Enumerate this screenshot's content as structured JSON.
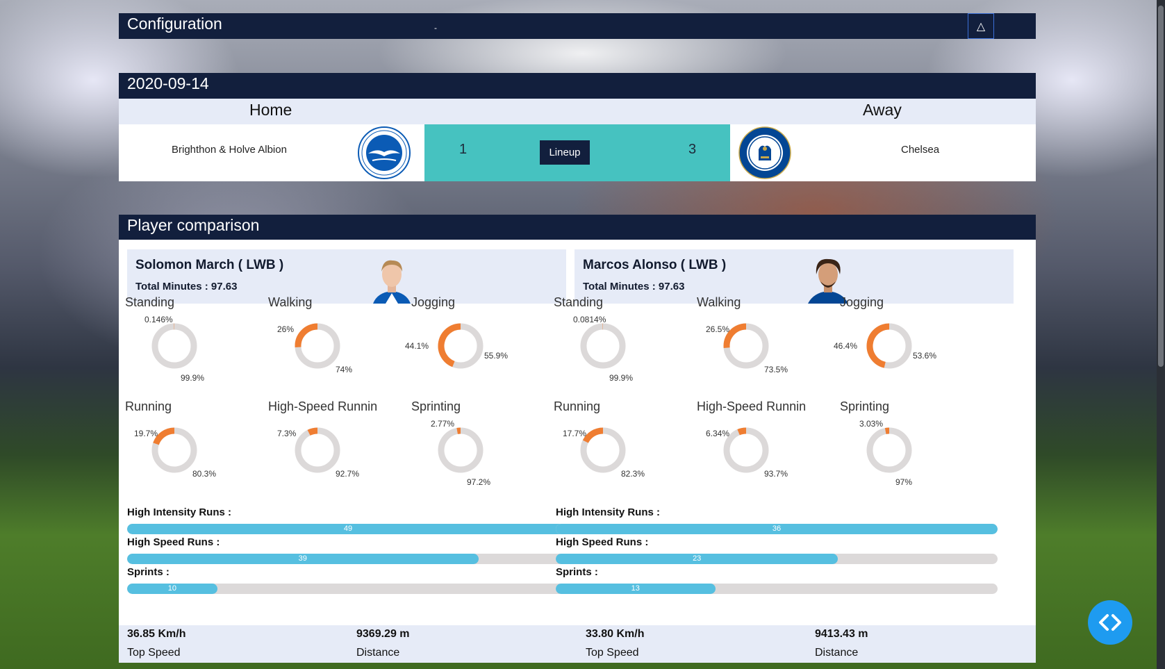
{
  "config": {
    "title": "Configuration",
    "dash": "-",
    "toggle_icon": "△"
  },
  "match": {
    "date": "2020-09-14",
    "home_label": "Home",
    "away_label": "Away",
    "home_team": "Brighthon & Holve Albion",
    "away_team": "Chelsea",
    "home_score": "1",
    "away_score": "3",
    "lineup_button": "Lineup",
    "home_logo_text": "BRIGHTON & HOVE ALBION",
    "away_logo_text": "CHELSEA FOOTBALL CLUB"
  },
  "comparison": {
    "title": "Player comparison",
    "players": [
      {
        "name": "Solomon March ( LWB )",
        "minutes": "Total Minutes : 97.63",
        "donuts": [
          {
            "title": "Standing",
            "a": "0.146%",
            "b": "99.9%",
            "fraction": 0.00146
          },
          {
            "title": "Walking",
            "a": "26%",
            "b": "74%",
            "fraction": 0.26
          },
          {
            "title": "Jogging",
            "a": "44.1%",
            "b": "55.9%",
            "fraction": 0.441
          },
          {
            "title": "Running",
            "a": "19.7%",
            "b": "80.3%",
            "fraction": 0.197
          },
          {
            "title": "High-Speed Runnin",
            "a": "7.3%",
            "b": "92.7%",
            "fraction": 0.073
          },
          {
            "title": "Sprinting",
            "a": "2.77%",
            "b": "97.2%",
            "fraction": 0.0277
          }
        ],
        "metrics": [
          {
            "label": "High Intensity Runs :",
            "value": "49",
            "fraction": 1.0
          },
          {
            "label": "High Speed Runs :",
            "value": "39",
            "fraction": 0.795
          },
          {
            "label": "Sprints :",
            "value": "10",
            "fraction": 0.204
          }
        ],
        "top_speed": "36.85 Km/h",
        "top_speed_label": "Top Speed",
        "distance": "9369.29 m",
        "distance_label": "Distance"
      },
      {
        "name": "Marcos Alonso ( LWB )",
        "minutes": "Total Minutes : 97.63",
        "donuts": [
          {
            "title": "Standing",
            "a": "0.0814%",
            "b": "99.9%",
            "fraction": 0.000814
          },
          {
            "title": "Walking",
            "a": "26.5%",
            "b": "73.5%",
            "fraction": 0.265
          },
          {
            "title": "Jogging",
            "a": "46.4%",
            "b": "53.6%",
            "fraction": 0.464
          },
          {
            "title": "Running",
            "a": "17.7%",
            "b": "82.3%",
            "fraction": 0.177
          },
          {
            "title": "High-Speed Runnin",
            "a": "6.34%",
            "b": "93.7%",
            "fraction": 0.0634
          },
          {
            "title": "Sprinting",
            "a": "3.03%",
            "b": "97%",
            "fraction": 0.0303
          }
        ],
        "metrics": [
          {
            "label": "High Intensity Runs :",
            "value": "36",
            "fraction": 1.0
          },
          {
            "label": "High Speed Runs :",
            "value": "23",
            "fraction": 0.639
          },
          {
            "label": "Sprints :",
            "value": "13",
            "fraction": 0.361
          }
        ],
        "top_speed": "33.80 Km/h",
        "top_speed_label": "Top Speed",
        "distance": "9413.43 m",
        "distance_label": "Distance"
      }
    ]
  },
  "colors": {
    "navy": "#121f3d",
    "teal": "#46c2c0",
    "orange": "#ef7d31",
    "ring_grey": "#dcd9d9",
    "bar_blue": "#56bfe0",
    "fab_blue": "#1e9bf0"
  }
}
